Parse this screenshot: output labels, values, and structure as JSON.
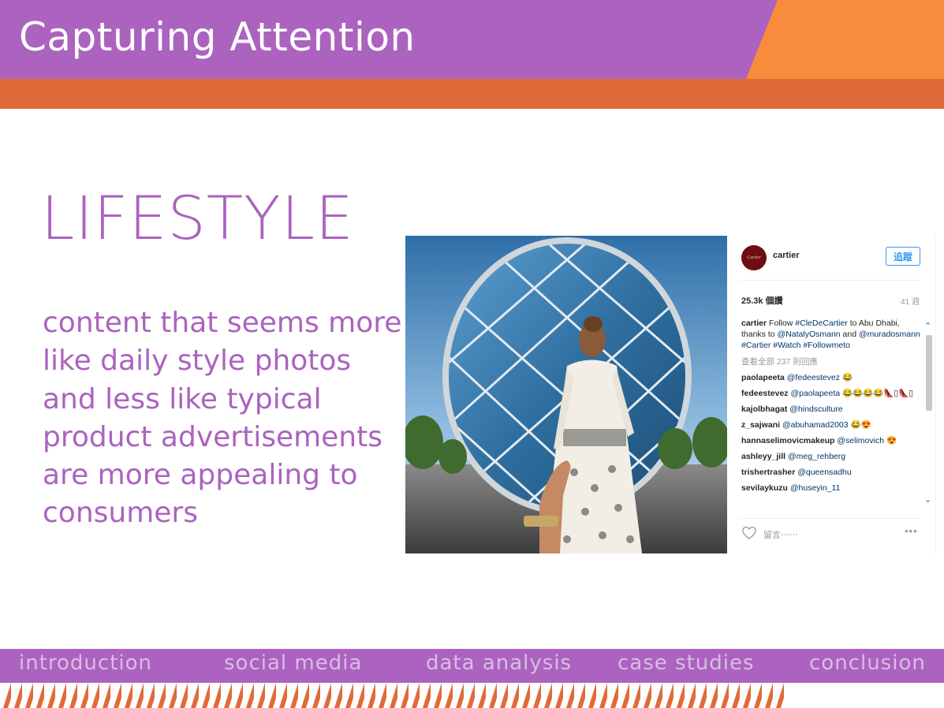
{
  "slide": {
    "title": "Capturing Attention",
    "heading": "LIFESTYLE",
    "body": "content that seems more like daily style photos and less like typical product advertisements are more appealing to consumers",
    "colors": {
      "purple": "#ab63bf",
      "orange": "#f98b3c",
      "dark_orange": "#e06b38",
      "nav_text": "#d9bde3"
    }
  },
  "instagram": {
    "avatar_text": "Cartier",
    "username": "cartier",
    "follow_label": "追蹤",
    "views": "25.3k 個讚",
    "age": "41 週",
    "caption": {
      "user": "cartier",
      "text_parts": [
        {
          "t": "Follow ",
          "link": false
        },
        {
          "t": "#CleDeCartier",
          "link": true
        },
        {
          "t": " to Abu Dhabi, thanks to ",
          "link": false
        },
        {
          "t": "@NatalyOsmann",
          "link": true
        },
        {
          "t": " and ",
          "link": false
        },
        {
          "t": "@muradosmann",
          "link": true
        },
        {
          "t": " ",
          "link": false
        },
        {
          "t": "#Cartier",
          "link": true
        },
        {
          "t": " ",
          "link": false
        },
        {
          "t": "#Watch",
          "link": true
        },
        {
          "t": " ",
          "link": false
        },
        {
          "t": "#Followmeto",
          "link": true
        }
      ]
    },
    "view_all": "查看全部 237 則回應",
    "comments": [
      {
        "user": "paolapeeta",
        "mention": "@fedeestevez",
        "suffix": " 😂"
      },
      {
        "user": "fedeestevez",
        "mention": "@paolapeeta",
        "suffix": " 😂😂😂😂👠▯👠▯"
      },
      {
        "user": "kajolbhagat",
        "mention": "@hindsculture",
        "suffix": ""
      },
      {
        "user": "z_sajwani",
        "mention": "@abuhamad2003",
        "suffix": " 😂😍"
      },
      {
        "user": "hannaselimovicmakeup",
        "mention": "@selimovich",
        "suffix": " 😍"
      },
      {
        "user": "ashleyy_jill",
        "mention": "@meg_rehberg",
        "suffix": ""
      },
      {
        "user": "trishertrasher",
        "mention": "@queensadhu",
        "suffix": ""
      },
      {
        "user": "sevilaykuzu",
        "mention": "@huseyin_11",
        "suffix": ""
      }
    ],
    "comment_placeholder": "留言⋯⋯",
    "more_label": "•••",
    "scroll_up": "⌃",
    "scroll_down": "⌄",
    "icons": {
      "like": "heart-icon",
      "more": "more-options-icon"
    }
  },
  "nav": {
    "items": [
      "introduction",
      "social media",
      "data analysis",
      "case studies",
      "conclusion"
    ]
  }
}
